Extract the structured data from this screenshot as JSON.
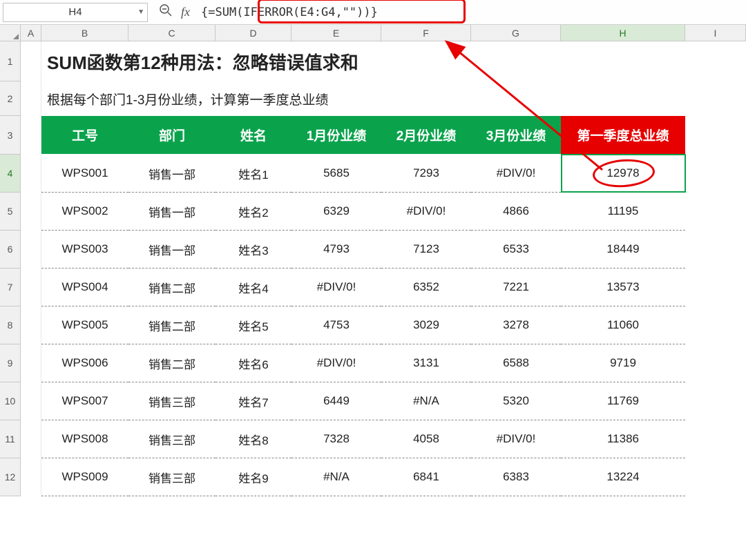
{
  "name_box": "H4",
  "formula": "{=SUM(IFERROR(E4:G4,\"\"))}",
  "columns": [
    "A",
    "B",
    "C",
    "D",
    "E",
    "F",
    "G",
    "H",
    "I"
  ],
  "selected_col": "H",
  "row_numbers": [
    "1",
    "2",
    "3",
    "4",
    "5",
    "6",
    "7",
    "8",
    "9",
    "10",
    "11",
    "12"
  ],
  "selected_row": "4",
  "title": "SUM函数第12种用法：忽略错误值求和",
  "subtitle": "根据每个部门1-3月份业绩，计算第一季度总业绩",
  "headers": {
    "b": "工号",
    "c": "部门",
    "d": "姓名",
    "e": "1月份业绩",
    "f": "2月份业绩",
    "g": "3月份业绩",
    "h": "第一季度总业绩"
  },
  "data": [
    {
      "id": "WPS001",
      "dept": "销售一部",
      "name": "姓名1",
      "m1": "5685",
      "m2": "7293",
      "m3": "#DIV/0!",
      "total": "12978"
    },
    {
      "id": "WPS002",
      "dept": "销售一部",
      "name": "姓名2",
      "m1": "6329",
      "m2": "#DIV/0!",
      "m3": "4866",
      "total": "11195"
    },
    {
      "id": "WPS003",
      "dept": "销售一部",
      "name": "姓名3",
      "m1": "4793",
      "m2": "7123",
      "m3": "6533",
      "total": "18449"
    },
    {
      "id": "WPS004",
      "dept": "销售二部",
      "name": "姓名4",
      "m1": "#DIV/0!",
      "m2": "6352",
      "m3": "7221",
      "total": "13573"
    },
    {
      "id": "WPS005",
      "dept": "销售二部",
      "name": "姓名5",
      "m1": "4753",
      "m2": "3029",
      "m3": "3278",
      "total": "11060"
    },
    {
      "id": "WPS006",
      "dept": "销售二部",
      "name": "姓名6",
      "m1": "#DIV/0!",
      "m2": "3131",
      "m3": "6588",
      "total": "9719"
    },
    {
      "id": "WPS007",
      "dept": "销售三部",
      "name": "姓名7",
      "m1": "6449",
      "m2": "#N/A",
      "m3": "5320",
      "total": "11769"
    },
    {
      "id": "WPS008",
      "dept": "销售三部",
      "name": "姓名8",
      "m1": "7328",
      "m2": "4058",
      "m3": "#DIV/0!",
      "total": "11386"
    },
    {
      "id": "WPS009",
      "dept": "销售三部",
      "name": "姓名9",
      "m1": "#N/A",
      "m2": "6841",
      "m3": "6383",
      "total": "13224"
    }
  ]
}
